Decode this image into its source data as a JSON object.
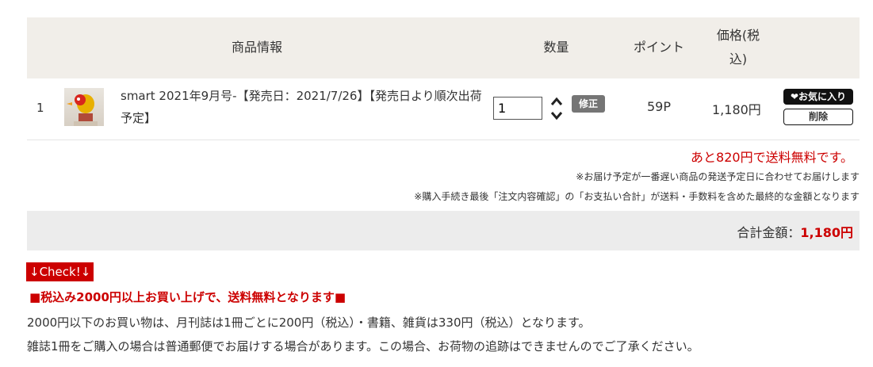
{
  "header": {
    "product_info": "商品情報",
    "quantity": "数量",
    "points": "ポイント",
    "price_line1": "価格(税",
    "price_line2": "込)"
  },
  "item": {
    "index": "1",
    "name": "smart 2021年9月号-【発売日：2021/7/26】【発売日より順次出荷予定】",
    "quantity": "1",
    "update_label": "修正",
    "points": "59P",
    "price": "1,180円",
    "favorite_label": "❤お気に入り",
    "delete_label": "削除"
  },
  "notes": {
    "shipping_remaining": "あと820円で送料無料です。",
    "note1": "※お届け予定が一番遅い商品の発送予定日に合わせてお届けします",
    "note2": "※購入手続き最後「注文内容確認」の「お支払い合計」が送料・手数料を含めた最終的な金額となります"
  },
  "total": {
    "label": "合計金額：",
    "value": "1,180円"
  },
  "info": {
    "check_label": "↓Check!↓",
    "headline": "■税込み2000円以上お買い上げで、送料無料となります■",
    "line1": "2000円以下のお買い物は、月刊誌は1冊ごとに200円（税込）・書籍、雑貨は330円（税込）となります。",
    "line2": "雑誌1冊をご購入の場合は普通郵便でお届けする場合があります。この場合、お荷物の追跡はできませんのでご了承ください。"
  },
  "colors": {
    "accent_red": "#cc0000",
    "header_bg": "#f1eee9"
  }
}
